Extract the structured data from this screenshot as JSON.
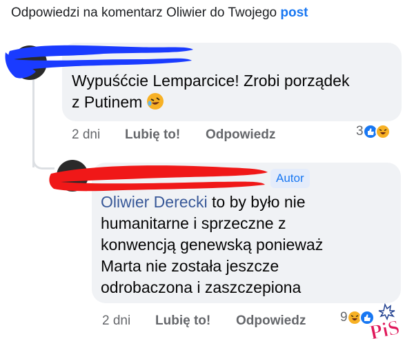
{
  "header": {
    "text": "Odpowiedzi na komentarz Oliwier do Twojego",
    "post_link": "post"
  },
  "comment1": {
    "text_line1": "Wypuśćcie Lemparcice! Zrobi porządek",
    "text_line2": "z Putinem",
    "emoji": "rolling-on-floor-laughing-emoji",
    "time": "2 dni",
    "like_label": "Lubię to!",
    "reply_label": "Odpowiedz",
    "reaction_count": "3",
    "reactions": [
      "like-icon",
      "haha-icon"
    ]
  },
  "comment2": {
    "author_badge": "Autor",
    "mention": "Oliwier Derecki",
    "text_after_mention": "to by było nie",
    "lines": [
      "humanitarne i sprzeczne z",
      "konwencją genewską ponieważ",
      "Marta nie została jeszcze",
      "odrobaczona i zaszczepiona"
    ],
    "time": "2 dni",
    "like_label": "Lubię to!",
    "reply_label": "Odpowiedz",
    "reaction_count": "9",
    "reactions": [
      "haha-icon",
      "like-icon"
    ]
  },
  "watermark": {
    "text": "PiS"
  },
  "colors": {
    "accent_blue": "#1877f2",
    "redact_blue": "#1a3bff",
    "redact_red": "#f01818",
    "bubble_bg": "#f0f2f5",
    "meta_gray": "#65676b"
  }
}
